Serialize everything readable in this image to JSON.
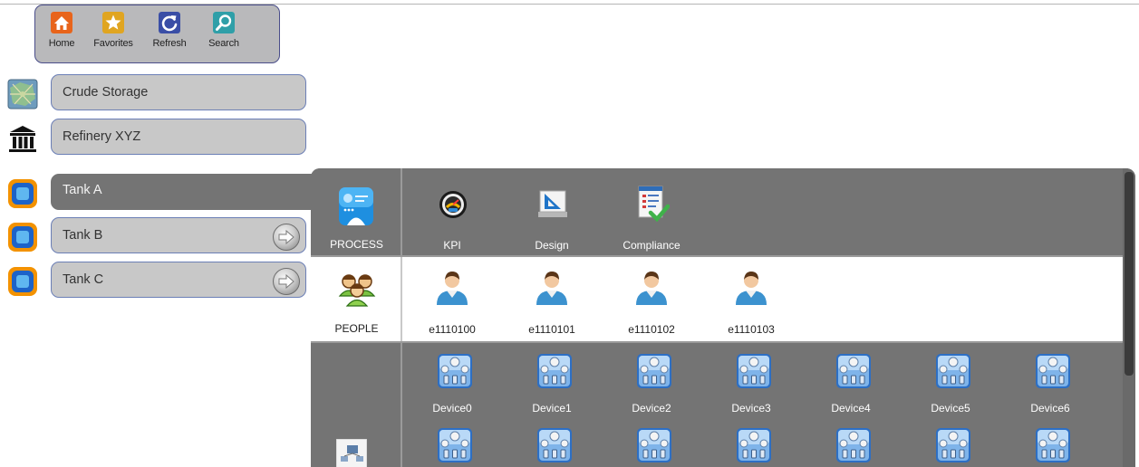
{
  "toolbar": {
    "home": "Home",
    "favorites": "Favorites",
    "refresh": "Refresh",
    "search": "Search"
  },
  "nav": [
    {
      "label": "Crude Storage",
      "icon": "map-icon"
    },
    {
      "label": "Refinery XYZ",
      "icon": "institution-icon"
    },
    {
      "label": "Tank A",
      "icon": "tank-icon"
    },
    {
      "label": "Tank B",
      "icon": "tank-icon"
    },
    {
      "label": "Tank C",
      "icon": "tank-icon"
    }
  ],
  "process": {
    "label": "PROCESS",
    "items": [
      "KPI",
      "Design",
      "Compliance"
    ]
  },
  "people": {
    "label": "PEOPLE",
    "items": [
      "e1110100",
      "e1110101",
      "e1110102",
      "e1110103"
    ]
  },
  "devices": {
    "items": [
      "Device0",
      "Device1",
      "Device2",
      "Device3",
      "Device4",
      "Device5",
      "Device6"
    ]
  },
  "colors": {
    "panel": "#747474",
    "toolbar": "#b9b9bb",
    "pill": "#c8c8c8",
    "pill_border": "#6b7fb6",
    "accent_orange": "#f39200"
  }
}
